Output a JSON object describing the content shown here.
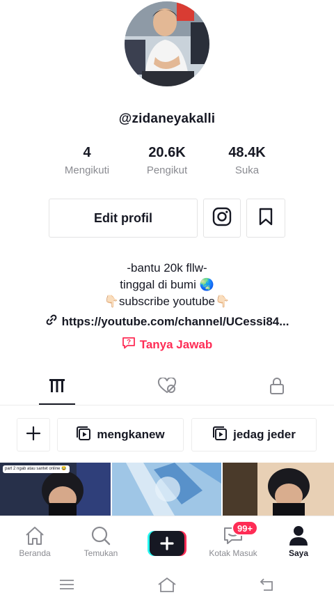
{
  "profile": {
    "username": "@zidaneyakalli",
    "stats": [
      {
        "value": "4",
        "label": "Mengikuti"
      },
      {
        "value": "20.6K",
        "label": "Pengikut"
      },
      {
        "value": "48.4K",
        "label": "Suka"
      }
    ],
    "edit_label": "Edit profil",
    "bio_lines": [
      "-bantu 20k fllw-",
      "tinggal di bumi 🌏",
      "👇🏻subscribe youtube👇🏻"
    ],
    "link": "https://youtube.com/channel/UCessi84...",
    "qa_label": "Tanya Jawab"
  },
  "tabs": [
    {
      "icon": "grid-icon",
      "active": true
    },
    {
      "icon": "liked-hidden-icon",
      "active": false
    },
    {
      "icon": "lock-icon",
      "active": false
    }
  ],
  "playlists": {
    "add_icon": "plus-icon",
    "items": [
      {
        "icon": "playlist-icon",
        "label": "mengkanew"
      },
      {
        "icon": "playlist-icon",
        "label": "jedag jeder"
      }
    ]
  },
  "videos": [
    {
      "caption": "part 2 ngab atau santet online 😂"
    },
    {
      "caption": ""
    },
    {
      "caption": ""
    }
  ],
  "nav": {
    "items": [
      {
        "icon": "home-icon",
        "label": "Beranda"
      },
      {
        "icon": "search-icon",
        "label": "Temukan"
      },
      {
        "icon": "create-icon",
        "label": ""
      },
      {
        "icon": "inbox-icon",
        "label": "Kotak Masuk"
      },
      {
        "icon": "profile-icon",
        "label": "Saya"
      }
    ],
    "badge": "99+",
    "active": "Saya"
  },
  "colors": {
    "accent": "#fe2c55",
    "text": "#161823",
    "muted": "#8a8b91",
    "cyan": "#25f4ee"
  }
}
